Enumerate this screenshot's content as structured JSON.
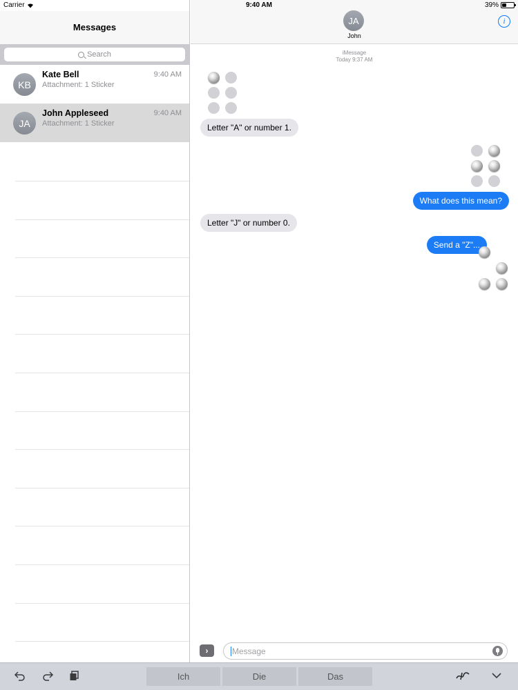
{
  "status_bar": {
    "carrier": "Carrier",
    "time": "9:40 AM",
    "battery": "39%",
    "battery_level": 0.39
  },
  "sidebar": {
    "title": "Messages",
    "search_placeholder": "Search",
    "conversations": [
      {
        "initials": "KB",
        "name": "Kate Bell",
        "time": "9:40 AM",
        "preview": "Attachment: 1 Sticker",
        "selected": false
      },
      {
        "initials": "JA",
        "name": "John Appleseed",
        "time": "9:40 AM",
        "preview": "Attachment: 1 Sticker",
        "selected": true
      }
    ]
  },
  "conversation": {
    "contact_initials": "JA",
    "contact_name": "John",
    "service": "iMessage",
    "timestamp": "Today 9:37 AM",
    "messages": [
      {
        "direction": "incoming",
        "type": "sticker",
        "braille_dots": [
          1
        ]
      },
      {
        "direction": "incoming",
        "type": "text",
        "text": "Letter \"A\" or number 1."
      },
      {
        "direction": "outgoing",
        "type": "sticker",
        "braille_dots": [
          2,
          4,
          5
        ]
      },
      {
        "direction": "outgoing",
        "type": "text",
        "text": "What does this mean?"
      },
      {
        "direction": "incoming",
        "type": "text",
        "text": "Letter \"J\" or number 0."
      },
      {
        "direction": "outgoing",
        "type": "text",
        "text": "Send a \"Z\"..."
      },
      {
        "direction": "outgoing",
        "type": "sticker",
        "braille_dots": [
          1,
          3,
          5,
          6
        ]
      }
    ],
    "input_placeholder": "Message"
  },
  "keyboard_bar": {
    "predictions": [
      "Ich",
      "Die",
      "Das"
    ]
  },
  "colors": {
    "outgoing_bubble": "#1b7cf6",
    "incoming_bubble": "#e5e5ea",
    "accent": "#0a7aff"
  },
  "icons": [
    "wifi-icon",
    "battery-icon",
    "search-icon",
    "info-icon",
    "expand-icon",
    "microphone-icon",
    "undo-icon",
    "redo-icon",
    "paste-icon",
    "handwriting-icon",
    "dismiss-keyboard-icon"
  ]
}
